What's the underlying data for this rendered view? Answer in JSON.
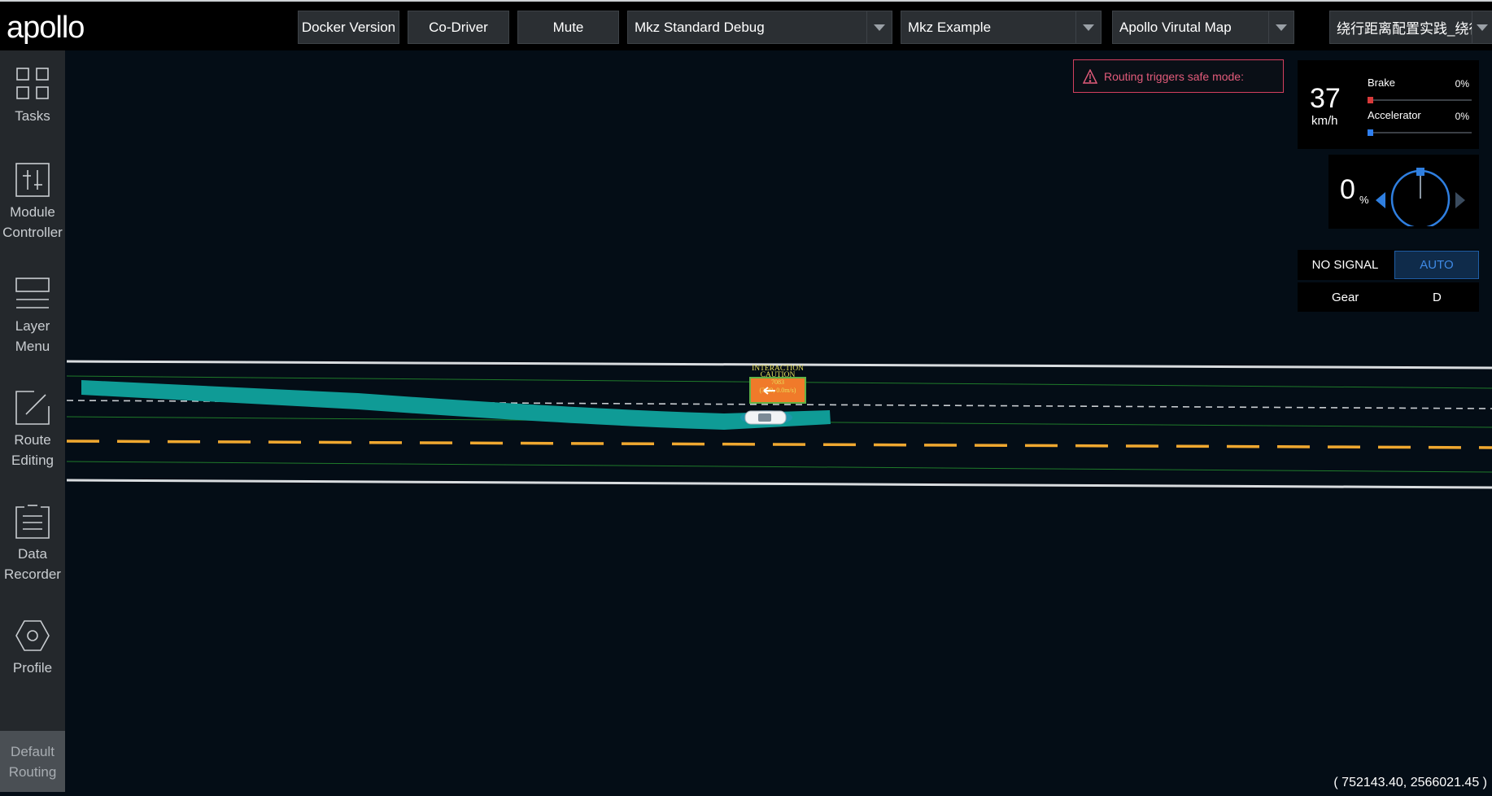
{
  "header": {
    "logo_text": "apollo",
    "docker_version_label": "Docker Version",
    "co_driver_label": "Co-Driver",
    "mute_label": "Mute",
    "mode_select": "Mkz Standard Debug",
    "vehicle_select": "Mkz Example",
    "map_select": "Apollo Virutal Map",
    "scenario_select": "绕行距离配置实践_绕行"
  },
  "sidebar": {
    "items": [
      {
        "label_line1": "Tasks",
        "label_line2": "",
        "icon": "grid-icon"
      },
      {
        "label_line1": "Module",
        "label_line2": "Controller",
        "icon": "sliders-icon"
      },
      {
        "label_line1": "Layer",
        "label_line2": "Menu",
        "icon": "layers-icon"
      },
      {
        "label_line1": "Route",
        "label_line2": "Editing",
        "icon": "route-icon"
      },
      {
        "label_line1": "Data",
        "label_line2": "Recorder",
        "icon": "clipboard-icon"
      },
      {
        "label_line1": "Profile",
        "label_line2": "",
        "icon": "hexagon-icon"
      }
    ],
    "default_routing_line1": "Default",
    "default_routing_line2": "Routing"
  },
  "alert": {
    "text": "Routing triggers safe mode:",
    "icon": "warning-icon",
    "color": "#e25b7a"
  },
  "dashboard": {
    "speed": "37",
    "speed_unit": "km/h",
    "brake_label": "Brake",
    "brake_value": "0%",
    "brake_color": "#d93a3a",
    "accelerator_label": "Accelerator",
    "accelerator_value": "0%",
    "accelerator_color": "#2f7ff0",
    "steering_value": "0",
    "steering_unit": "%",
    "signal": "NO SIGNAL",
    "driving_mode": "AUTO",
    "gear_label": "Gear",
    "gear_value": "D"
  },
  "scene": {
    "obstacle_line1": "INTERACTION",
    "obstacle_line2": "CAUTION",
    "obstacle_id": "7083",
    "obstacle_speed": "(3.29, 0.0m/s)",
    "lane_divider_color": "#f0a830",
    "planning_path_color": "#0f9b96"
  },
  "coordinates": "( 752143.40, 2566021.45 )"
}
